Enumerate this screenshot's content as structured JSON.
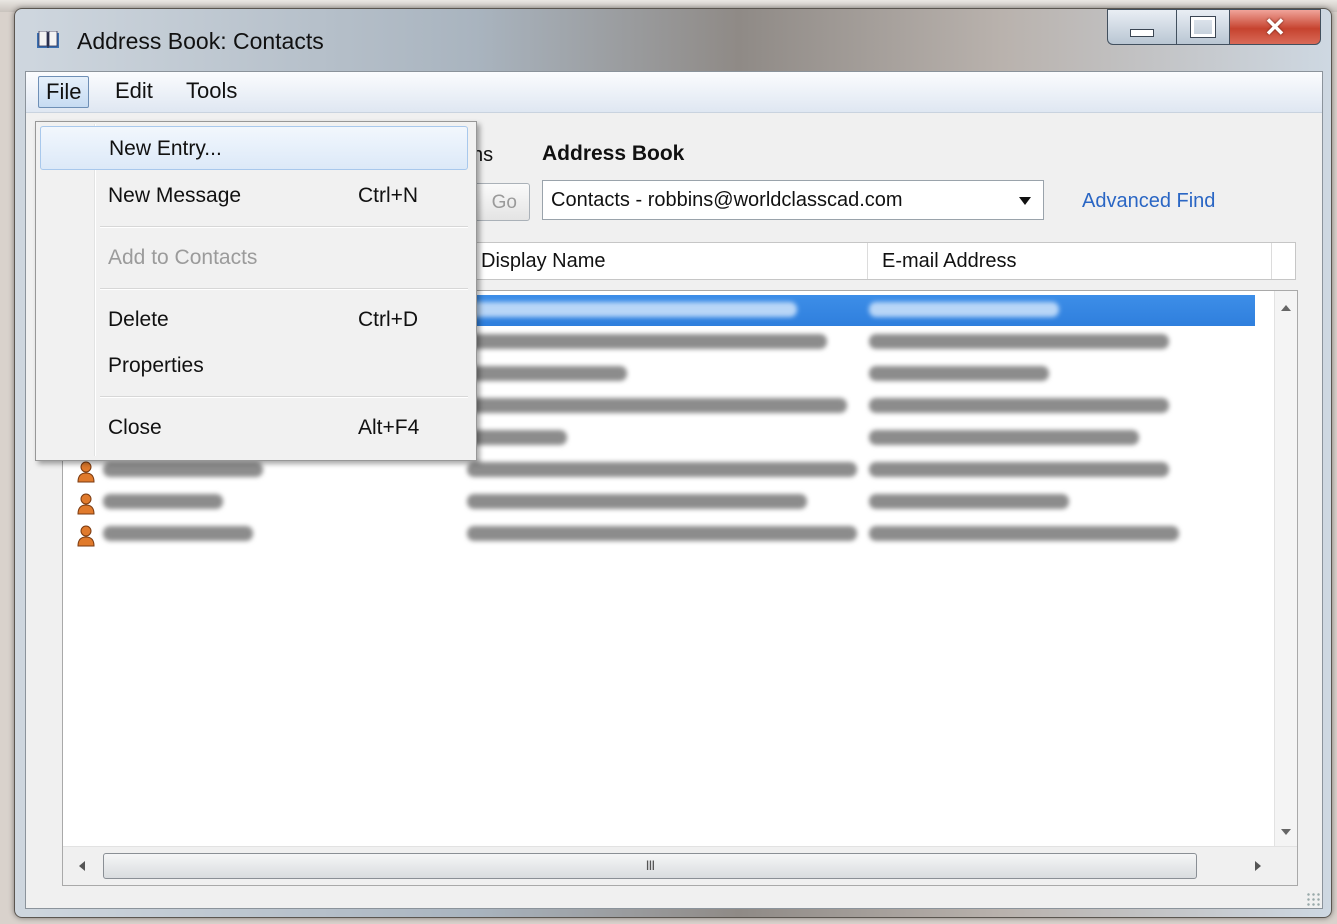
{
  "window": {
    "title": "Address Book: Contacts",
    "controls": {
      "minimize": "minimize",
      "maximize": "maximize",
      "close": "close"
    }
  },
  "menubar": {
    "items": [
      {
        "label": "File"
      },
      {
        "label": "Edit"
      },
      {
        "label": "Tools"
      }
    ]
  },
  "file_menu": {
    "items": [
      {
        "label": "New Entry...",
        "shortcut": "",
        "state": "highlighted"
      },
      {
        "label": "New Message",
        "shortcut": "Ctrl+N",
        "state": "enabled"
      },
      {
        "label": "Add to Contacts",
        "shortcut": "",
        "state": "disabled"
      },
      {
        "label": "Delete",
        "shortcut": "Ctrl+D",
        "state": "enabled"
      },
      {
        "label": "Properties",
        "shortcut": "",
        "state": "enabled"
      },
      {
        "label": "Close",
        "shortcut": "Alt+F4",
        "state": "enabled"
      }
    ]
  },
  "toolbar": {
    "search_label_partial": "ns",
    "go_label": "Go",
    "address_book_label": "Address Book",
    "address_book_value": "Contacts - robbins@worldclasscad.com",
    "advanced_find": "Advanced Find"
  },
  "list": {
    "columns": {
      "display_name": "Display Name",
      "email": "E-mail Address"
    },
    "scroll_thumb_glyph": "III"
  },
  "colors": {
    "selection": "#3388e4",
    "link": "#2a66c4",
    "menu_highlight": "#dce9f8"
  }
}
